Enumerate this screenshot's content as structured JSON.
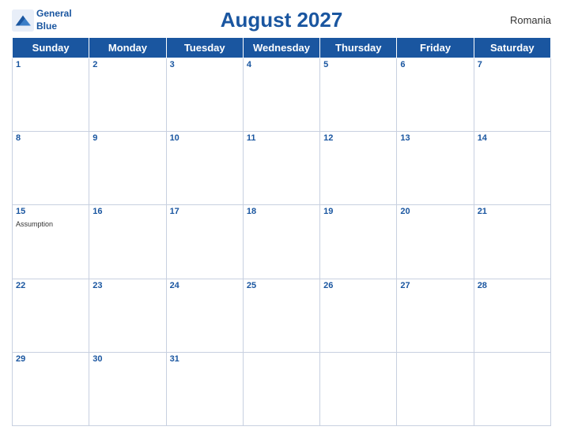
{
  "header": {
    "title": "August 2027",
    "country": "Romania",
    "logo": {
      "line1": "General",
      "line2": "Blue"
    }
  },
  "days": [
    "Sunday",
    "Monday",
    "Tuesday",
    "Wednesday",
    "Thursday",
    "Friday",
    "Saturday"
  ],
  "weeks": [
    [
      {
        "date": "1",
        "holiday": ""
      },
      {
        "date": "2",
        "holiday": ""
      },
      {
        "date": "3",
        "holiday": ""
      },
      {
        "date": "4",
        "holiday": ""
      },
      {
        "date": "5",
        "holiday": ""
      },
      {
        "date": "6",
        "holiday": ""
      },
      {
        "date": "7",
        "holiday": ""
      }
    ],
    [
      {
        "date": "8",
        "holiday": ""
      },
      {
        "date": "9",
        "holiday": ""
      },
      {
        "date": "10",
        "holiday": ""
      },
      {
        "date": "11",
        "holiday": ""
      },
      {
        "date": "12",
        "holiday": ""
      },
      {
        "date": "13",
        "holiday": ""
      },
      {
        "date": "14",
        "holiday": ""
      }
    ],
    [
      {
        "date": "15",
        "holiday": "Assumption"
      },
      {
        "date": "16",
        "holiday": ""
      },
      {
        "date": "17",
        "holiday": ""
      },
      {
        "date": "18",
        "holiday": ""
      },
      {
        "date": "19",
        "holiday": ""
      },
      {
        "date": "20",
        "holiday": ""
      },
      {
        "date": "21",
        "holiday": ""
      }
    ],
    [
      {
        "date": "22",
        "holiday": ""
      },
      {
        "date": "23",
        "holiday": ""
      },
      {
        "date": "24",
        "holiday": ""
      },
      {
        "date": "25",
        "holiday": ""
      },
      {
        "date": "26",
        "holiday": ""
      },
      {
        "date": "27",
        "holiday": ""
      },
      {
        "date": "28",
        "holiday": ""
      }
    ],
    [
      {
        "date": "29",
        "holiday": ""
      },
      {
        "date": "30",
        "holiday": ""
      },
      {
        "date": "31",
        "holiday": ""
      },
      {
        "date": "",
        "holiday": ""
      },
      {
        "date": "",
        "holiday": ""
      },
      {
        "date": "",
        "holiday": ""
      },
      {
        "date": "",
        "holiday": ""
      }
    ]
  ],
  "colors": {
    "header_bg": "#1a56a0",
    "header_text": "#ffffff",
    "title_color": "#1a56a0"
  }
}
